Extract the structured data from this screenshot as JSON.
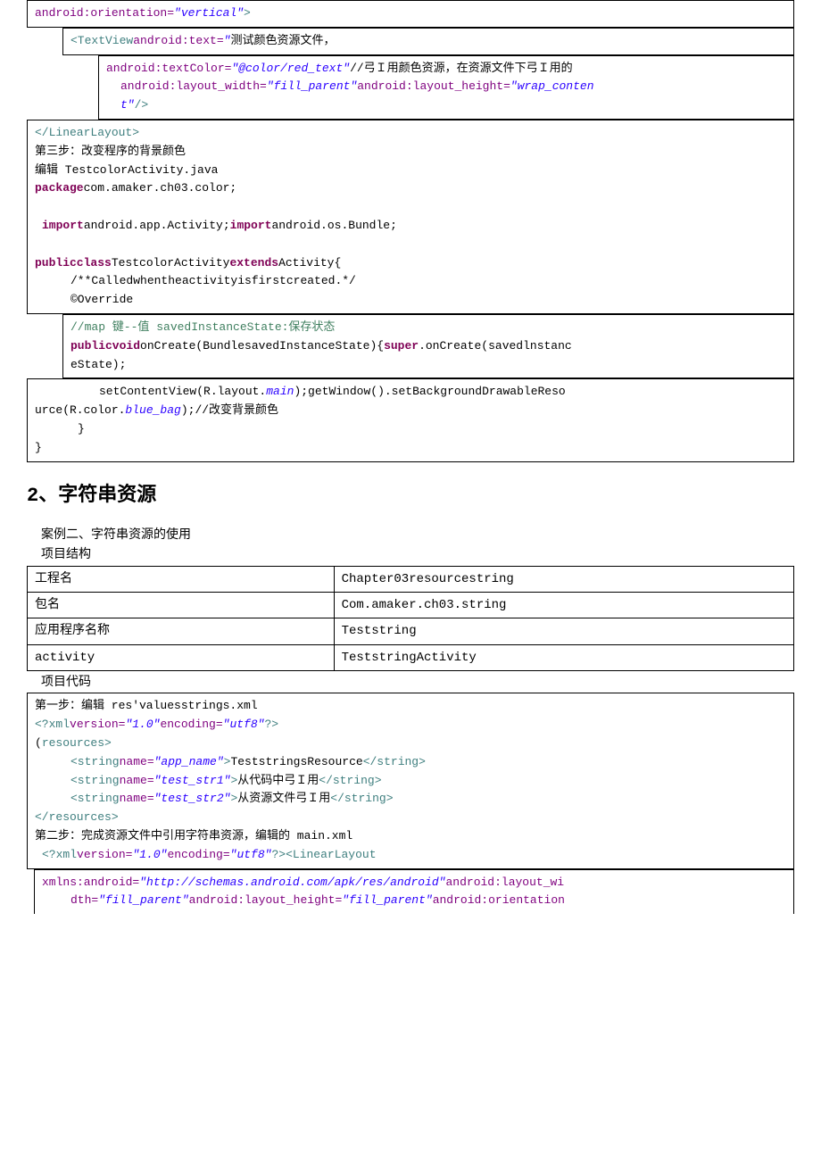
{
  "block1": {
    "l1a": "android:orientation=",
    "l1b": "\"vertical\"",
    "l1c": ">"
  },
  "block2": {
    "l1a": "<TextView",
    "l1b": "android:text=",
    "l1c": "\"",
    "l1d": "测试颜色资源文件，"
  },
  "block3": {
    "l1a": "android:textColor=",
    "l1b": "\"@color/red_text\"",
    "l1c": "//弓Ｉ用颜色资源，在资源文件下弓Ｉ用的",
    "l2a": "android:layout_width=",
    "l2b": "\"fill_parent\"",
    "l2c": "android:layout_height=",
    "l2d": "\"wrap_conten",
    "l3a": "t\"",
    "l3b": "/>"
  },
  "block4": {
    "l1": "</LinearLayout>",
    "l2": "第三步：改变程序的背景颜色",
    "l3": "编辑 TestcolorActivity.java",
    "l4a": "package",
    "l4b": "com.amaker.ch03.color;",
    "l5a": "import",
    "l5b": "android.app.Activity;",
    "l5c": "import",
    "l5d": "android.os.Bundle;",
    "l6a": "publicclass",
    "l6b": "TestcolorActivity",
    "l6c": "extends",
    "l6d": "Activity{",
    "l7": "/**Calledwhentheactivityisfirstcreated.*/",
    "l8": "©Override"
  },
  "block5": {
    "l1": "//map 键--值 savedInstanceState:保存状态",
    "l2a": "publicvoid",
    "l2b": "onCreate(BundlesavedInstanceState){",
    "l2c": "super",
    "l2d": ".onCreate(savedlnstanc",
    "l3": "eState);"
  },
  "block6": {
    "l1a": "setContentView(R.layout.",
    "l1b": "main",
    "l1c": ");getWindow().setBackgroundDrawableReso",
    "l2a": "urce(R.color.",
    "l2b": "blue_bag",
    "l2c": ");//改变背景颜色",
    "l3": "}",
    "l4": "}"
  },
  "heading": "2、字符串资源",
  "case2": "案例二、字符串资源的使用",
  "proj_struct": "项目结构",
  "table": {
    "r1a": "工程名",
    "r1b": "Chapter03resourcestring",
    "r2a": "包名",
    "r2b": "Com.amaker.ch03.string",
    "r3a": "应用程序名称",
    "r3b": "Teststring",
    "r4a": "activity",
    "r4b": "TeststringActivity"
  },
  "proj_code": "项目代码",
  "block7": {
    "l1": "第一步：编辑 res'valuesstrings.xml",
    "l2a": "<?xml",
    "l2b": "version=",
    "l2c": "\"1.0\"",
    "l2d": "encoding=",
    "l2e": "\"utf8\"",
    "l2f": "?>",
    "l3a": "(",
    "l3b": "resources",
    "l3c": ">",
    "l4a": "<string",
    "l4b": "name=",
    "l4c": "\"app_name\"",
    "l4d": ">",
    "l4e": "TeststringsResource",
    "l4f": "</string>",
    "l5a": "<string",
    "l5b": "name=",
    "l5c": "\"test_str1\"",
    "l5d": ">",
    "l5e": "从代码中弓Ｉ用",
    "l5f": "</string>",
    "l6a": "<string",
    "l6b": "name=",
    "l6c": "\"test_str2\"",
    "l6d": ">",
    "l6e": "从资源文件弓Ｉ用",
    "l6f": "</string>",
    "l7": "</resources>",
    "l8": "第二步：完成资源文件中引用字符串资源，编辑的 main.xml",
    "l9a": "<?xml",
    "l9b": "version=",
    "l9c": "\"1.0\"",
    "l9d": "encoding=",
    "l9e": "\"utf8\"",
    "l9f": "?>",
    "l9g": "<LinearLayout"
  },
  "block8": {
    "l1a": "xmlns:android=",
    "l1b": "\"http://schemas.android.com/apk/res/android\"",
    "l1c": "android:layout_wi",
    "l2a": "dth=",
    "l2b": "\"fill_parent\"",
    "l2c": "android:layout_height=",
    "l2d": "\"fill_parent\"",
    "l2e": "android:orientation"
  }
}
